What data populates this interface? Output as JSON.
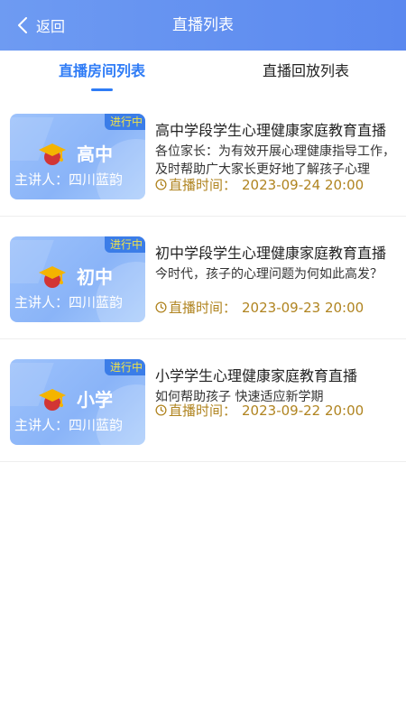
{
  "header": {
    "back_label": "返回",
    "title": "直播列表"
  },
  "tabs": [
    {
      "label": "直播房间列表",
      "active": true
    },
    {
      "label": "直播回放列表",
      "active": false
    }
  ],
  "colors": {
    "header_gradient_start": "#6e9bf2",
    "header_gradient_end": "#5a88ef",
    "accent": "#2f7cf6",
    "time_text": "#b08420",
    "badge_text": "#efe24a",
    "cap_color": "#e03e3e"
  },
  "items": [
    {
      "status": "进行中",
      "level": "高中",
      "speaker": "主讲人：四川蓝韵",
      "title": "高中学段学生心理健康家庭教育直播",
      "desc": "各位家长：为有效开展心理健康指导工作，及时帮助广大家长更好地了解孩子心理",
      "time_label": "直播时间：",
      "time_value": "2023-09-24 20:00",
      "icon": "graduation-cap-icon"
    },
    {
      "status": "进行中",
      "level": "初中",
      "speaker": "主讲人：四川蓝韵",
      "title": "初中学段学生心理健康家庭教育直播",
      "desc": "今时代，孩子的心理问题为何如此高发？",
      "time_label": "直播时间：",
      "time_value": "2023-09-23 20:00",
      "icon": "graduation-cap-icon"
    },
    {
      "status": "进行中",
      "level": "小学",
      "speaker": "主讲人：四川蓝韵",
      "title": "小学学生心理健康家庭教育直播",
      "desc": "如何帮助孩子 快速适应新学期",
      "time_label": "直播时间：",
      "time_value": "2023-09-22 20:00",
      "icon": "graduation-cap-icon"
    }
  ]
}
